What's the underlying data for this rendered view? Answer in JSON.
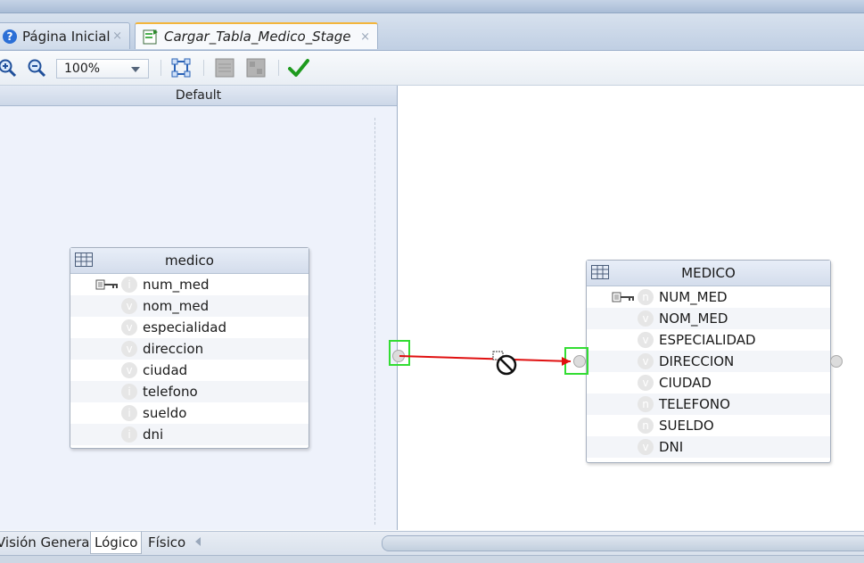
{
  "tabs": [
    {
      "label": "Página Inicial",
      "close": "×",
      "icon": "help-icon"
    },
    {
      "label": "Cargar_Tabla_Medico_Stage",
      "close": "×",
      "icon": "mapping-diagram-icon"
    }
  ],
  "toolbar": {
    "zoom_value": "100%",
    "buttons": [
      "zoom-in-icon",
      "zoom-out-icon",
      "fit-diagram-icon",
      "layout-icon",
      "layout-alt-icon",
      "validate-check-icon"
    ]
  },
  "panel": {
    "title": "Default"
  },
  "source_table": {
    "name": "medico",
    "columns": [
      {
        "name": "num_med",
        "key": true,
        "type_glyph": "i"
      },
      {
        "name": "nom_med",
        "key": false,
        "type_glyph": "v"
      },
      {
        "name": "especialidad",
        "key": false,
        "type_glyph": "v"
      },
      {
        "name": "direccion",
        "key": false,
        "type_glyph": "v"
      },
      {
        "name": "ciudad",
        "key": false,
        "type_glyph": "v"
      },
      {
        "name": "telefono",
        "key": false,
        "type_glyph": "i"
      },
      {
        "name": "sueldo",
        "key": false,
        "type_glyph": "i"
      },
      {
        "name": "dni",
        "key": false,
        "type_glyph": "i"
      }
    ]
  },
  "target_table": {
    "name": "MEDICO",
    "columns": [
      {
        "name": "NUM_MED",
        "key": true,
        "type_glyph": "n"
      },
      {
        "name": "NOM_MED",
        "key": false,
        "type_glyph": "v"
      },
      {
        "name": "ESPECIALIDAD",
        "key": false,
        "type_glyph": "v"
      },
      {
        "name": "DIRECCION",
        "key": false,
        "type_glyph": "v"
      },
      {
        "name": "CIUDAD",
        "key": false,
        "type_glyph": "v"
      },
      {
        "name": "TELEFONO",
        "key": false,
        "type_glyph": "n"
      },
      {
        "name": "SUELDO",
        "key": false,
        "type_glyph": "n"
      },
      {
        "name": "DNI",
        "key": false,
        "type_glyph": "v"
      }
    ]
  },
  "bottom_tabs": [
    {
      "label": "Visión General",
      "active": false
    },
    {
      "label": "Lógico",
      "active": true
    },
    {
      "label": "Físico",
      "active": false
    }
  ],
  "colors": {
    "connector": "#e01010",
    "highlight": "#33dd33",
    "active_tab_accent": "#f3b53b"
  }
}
